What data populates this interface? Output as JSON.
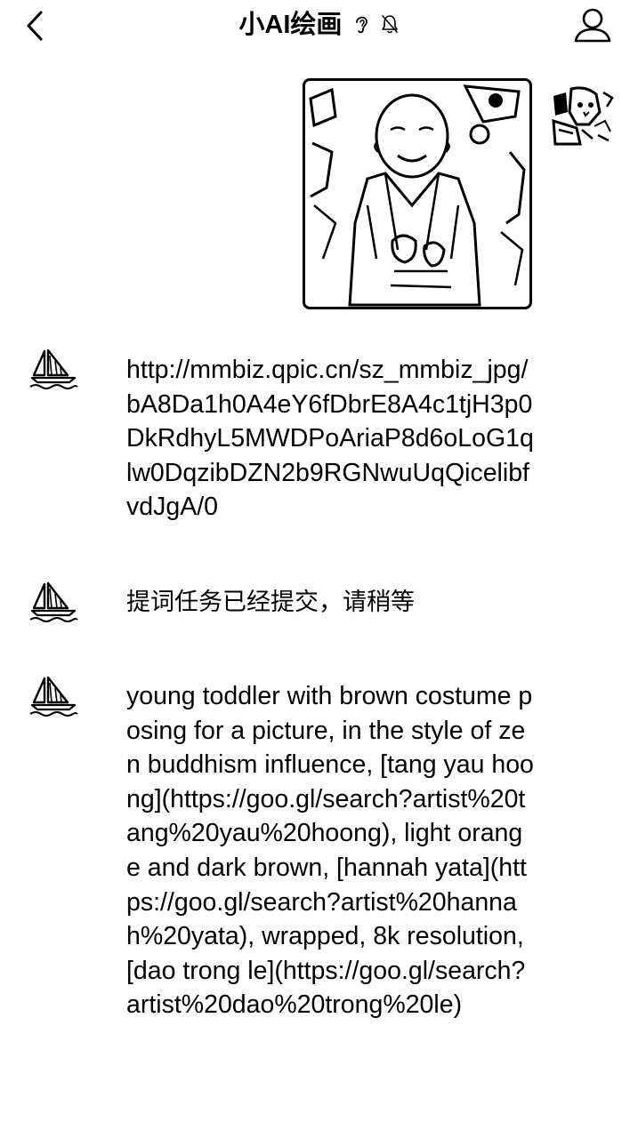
{
  "header": {
    "title": "小AI绘画",
    "back_icon": "chevron-left-icon",
    "ear_icon": "ear-icon",
    "mute_icon": "bell-slash-icon",
    "profile_icon": "person-icon"
  },
  "messages": [
    {
      "sender": "self",
      "type": "image",
      "image_desc_icon": "monk-child-illustration"
    },
    {
      "sender": "bot",
      "type": "text",
      "text": "http://mmbiz.qpic.cn/sz_mmbiz_jpg/bA8Da1h0A4eY6fDbrE8A4c1tjH3p0DkRdhyL5MWDPoAriaP8d6oLoG1qlw0DqzibDZN2b9RGNwuUqQicelibfvdJgA/0"
    },
    {
      "sender": "bot",
      "type": "text",
      "text": "提词任务已经提交，请稍等"
    },
    {
      "sender": "bot",
      "type": "text",
      "text": "young toddler with brown costume posing for a picture, in the style of zen buddhism influence, [tang yau hoong](https://goo.gl/search?artist%20tang%20yau%20hoong), light orange and dark brown, [hannah yata](https://goo.gl/search?artist%20hannah%20yata), wrapped, 8k resolution, [dao trong le](https://goo.gl/search?artist%20dao%20trong%20le)"
    }
  ]
}
